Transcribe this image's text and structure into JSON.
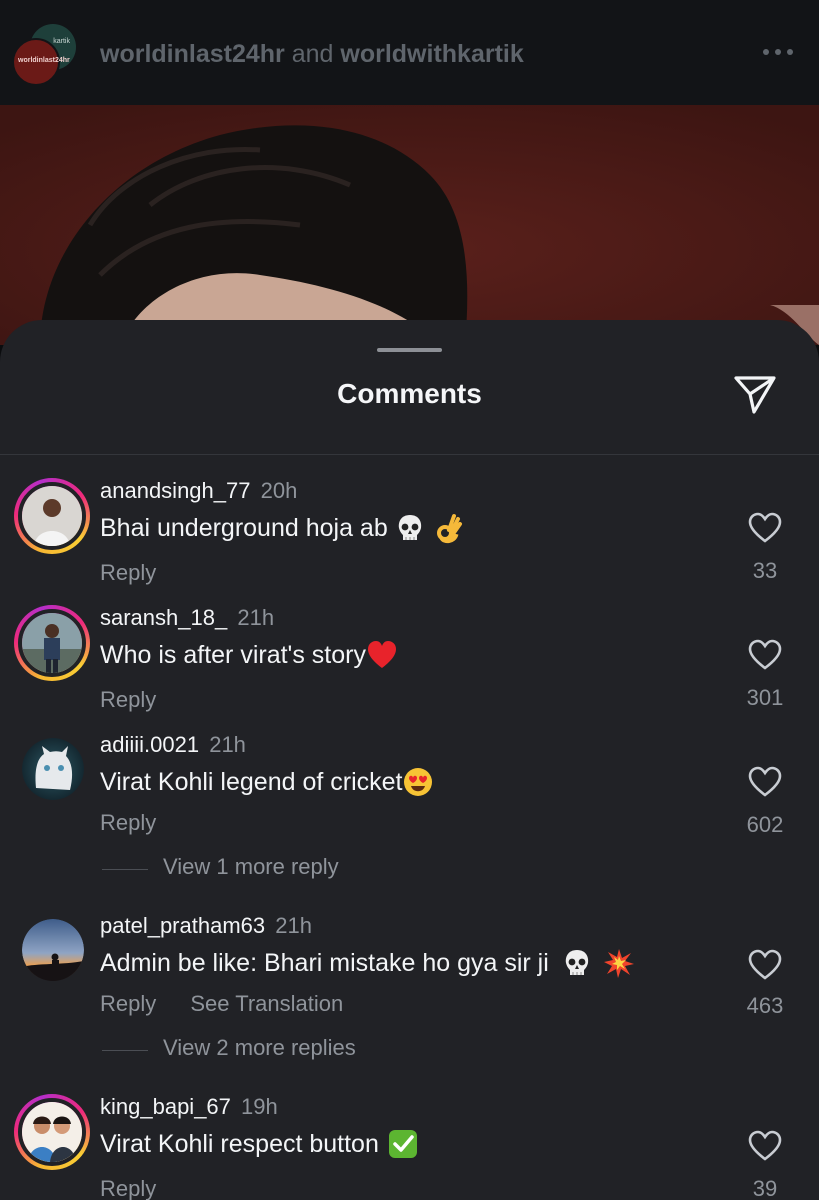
{
  "header": {
    "front_avatar_text": "worldinlast24hr",
    "back_avatar_text": "kartik",
    "user1": "worldinlast24hr",
    "joiner": "and",
    "user2": "worldwithkartik",
    "more_icon": "more-horizontal-icon"
  },
  "sheet": {
    "title": "Comments",
    "share_icon": "send-paper-plane-icon"
  },
  "comments": [
    {
      "username": "anandsingh_77",
      "time": "20h",
      "text": "Bhai underground hoja ab",
      "emojis": [
        "skull",
        "ok-hand"
      ],
      "reply_label": "Reply",
      "likes": "33"
    },
    {
      "username": "saransh_18_",
      "time": "21h",
      "text": "Who is after virat's story",
      "emojis": [
        "red-heart"
      ],
      "reply_label": "Reply",
      "likes": "301"
    },
    {
      "username": "adiiii.0021",
      "time": "21h",
      "text": "Virat Kohli legend of cricket",
      "emojis": [
        "heart-eyes"
      ],
      "reply_label": "Reply",
      "likes": "602",
      "more_replies": "View 1 more reply"
    },
    {
      "username": "patel_pratham63",
      "time": "21h",
      "text": "Admin be like: Bhari mistake ho gya sir ji",
      "emojis": [
        "skull",
        "collision"
      ],
      "reply_label": "Reply",
      "translate_label": "See Translation",
      "likes": "463",
      "more_replies": "View 2 more replies"
    },
    {
      "username": "king_bapi_67",
      "time": "19h",
      "text": "Virat Kohli respect button",
      "emojis": [
        "check-mark-button"
      ],
      "reply_label": "Reply",
      "likes": "39"
    }
  ],
  "colors": {
    "sheet_bg": "#212226",
    "secondary_text": "#8f949b",
    "primary_text": "#f3f5f7",
    "story_ring": "#ee2a7b"
  }
}
